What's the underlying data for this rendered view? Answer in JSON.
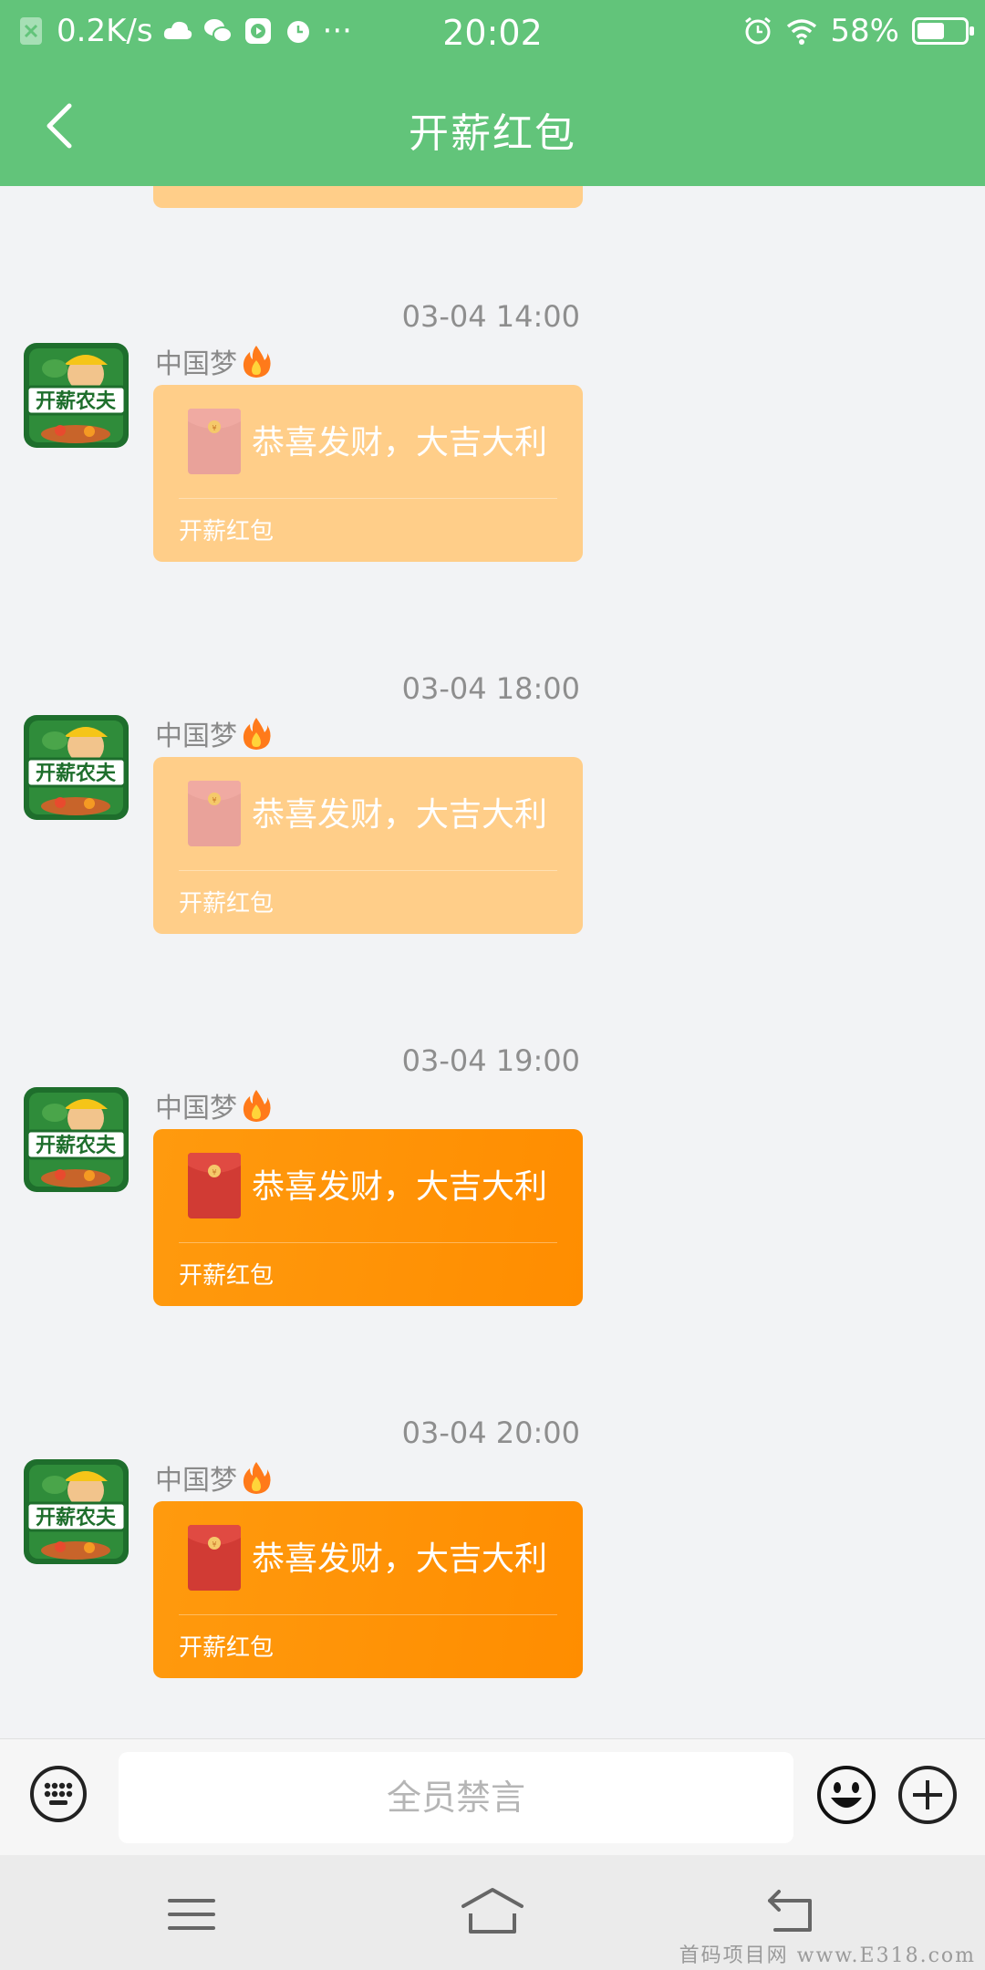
{
  "status_bar": {
    "net_speed": "0.2K/s",
    "time": "20:02",
    "battery_percent": "58%",
    "battery_level": 0.58,
    "more": "···",
    "icons": [
      "sim-x-icon",
      "cloud-icon",
      "wechat-icon",
      "video-icon",
      "alarm-icon",
      "alarm-icon",
      "wifi-icon",
      "battery-icon"
    ]
  },
  "header": {
    "title": "开薪红包",
    "back_icon": "chevron-left-icon"
  },
  "messages": [
    {
      "time": "03-04 14:00",
      "sender": "中国梦",
      "badge_icon": "fire-icon",
      "greeting": "恭喜发财，大吉大利",
      "card_type": "开薪红包",
      "state": "opened"
    },
    {
      "time": "03-04 18:00",
      "sender": "中国梦",
      "badge_icon": "fire-icon",
      "greeting": "恭喜发财，大吉大利",
      "card_type": "开薪红包",
      "state": "opened"
    },
    {
      "time": "03-04 19:00",
      "sender": "中国梦",
      "badge_icon": "fire-icon",
      "greeting": "恭喜发财，大吉大利",
      "card_type": "开薪红包",
      "state": "unopened"
    },
    {
      "time": "03-04 20:00",
      "sender": "中国梦",
      "badge_icon": "fire-icon",
      "greeting": "恭喜发财，大吉大利",
      "card_type": "开薪红包",
      "state": "unopened"
    }
  ],
  "avatar_logo_text": "开薪农夫",
  "input_bar": {
    "placeholder": "全员禁言",
    "left_icon": "keyboard-icon",
    "emoji_icon": "emoji-icon",
    "plus_icon": "plus-icon"
  },
  "nav_bar": {
    "icons": [
      "menu-icon",
      "home-icon",
      "back-icon"
    ]
  },
  "watermark": "首码项目网 www.E318.com",
  "colors": {
    "header_green": "#62c47a",
    "card_opened": "#ffce89",
    "card_unopened": "#ff9500",
    "envelope_red": "#d13b34",
    "envelope_faded": "#e9a29a"
  }
}
